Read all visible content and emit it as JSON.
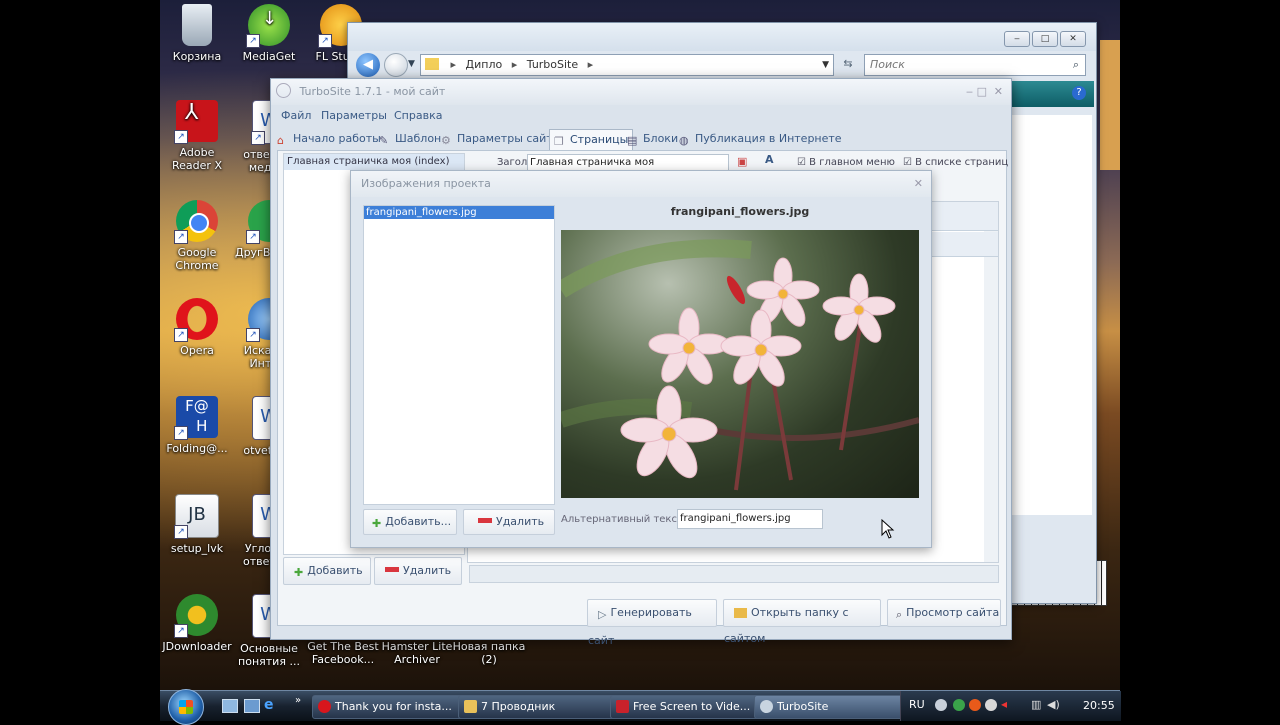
{
  "desktop": {
    "icons": [
      {
        "label": "Корзина"
      },
      {
        "label": "MediaGet"
      },
      {
        "label": "FL Studio"
      },
      {
        "label": "Adobe Reader X"
      },
      {
        "label": "ответы в меди..."
      },
      {
        "label": "Google Chrome"
      },
      {
        "label": "ДругВокруг"
      },
      {
        "label": "Opera"
      },
      {
        "label": "Искать в Инте..."
      },
      {
        "label": "Folding@..."
      },
      {
        "label": "otvety_..."
      },
      {
        "label": "setup_lvk"
      },
      {
        "label": "Угловые ответы..."
      },
      {
        "label": "JDownloader"
      },
      {
        "label": "Основные понятия ..."
      },
      {
        "label": "Get The Best Facebook..."
      },
      {
        "label": "Hamster Lite Archiver"
      },
      {
        "label": "Новая папка (2)"
      }
    ]
  },
  "explorer": {
    "breadcrumb": [
      "Диплo",
      "TurboSite"
    ],
    "search_placeholder": "Поиск"
  },
  "turbosite": {
    "title": "TurboSite 1.7.1 - мой сайт",
    "menu": [
      "Файл",
      "Параметры",
      "Справка"
    ],
    "tabs": [
      {
        "label": "Начало работы"
      },
      {
        "label": "Шаблон"
      },
      {
        "label": "Параметры сайта"
      },
      {
        "label": "Страницы",
        "active": true
      },
      {
        "label": "Блоки"
      },
      {
        "label": "Публикация в Интернете"
      }
    ],
    "page_list_selected": "Главная страничка моя (index)",
    "heading_label": "Заголовок:",
    "heading_value": "Главная страничка моя",
    "check_main_menu": "В главном меню",
    "check_page_list": "В списке страниц",
    "add_button": "Добавить",
    "delete_button": "Удалить",
    "generate_button": "Генерировать сайт",
    "open_folder_button": "Открыть папку с сайтом",
    "preview_button": "Просмотр сайта"
  },
  "dialog": {
    "title": "Изображения проекта",
    "files": [
      "frangipani_flowers.jpg"
    ],
    "preview_caption": "frangipani_flowers.jpg",
    "add_button": "Добавить...",
    "delete_button": "Удалить",
    "alt_label": "Альтернативный текст:",
    "alt_value": "frangipani_flowers.jpg"
  },
  "taskbar": {
    "tasks": [
      {
        "label": "Thank you for insta..."
      },
      {
        "label": "7 Проводник"
      },
      {
        "label": "Free Screen to Vide..."
      },
      {
        "label": "TurboSite",
        "active": true
      }
    ],
    "lang": "RU",
    "clock": "20:55"
  },
  "colors": {
    "accent": "#3a5a85",
    "selection": "#3d7fd8",
    "add_green": "#4aa73c",
    "delete_red": "#d9363e"
  }
}
